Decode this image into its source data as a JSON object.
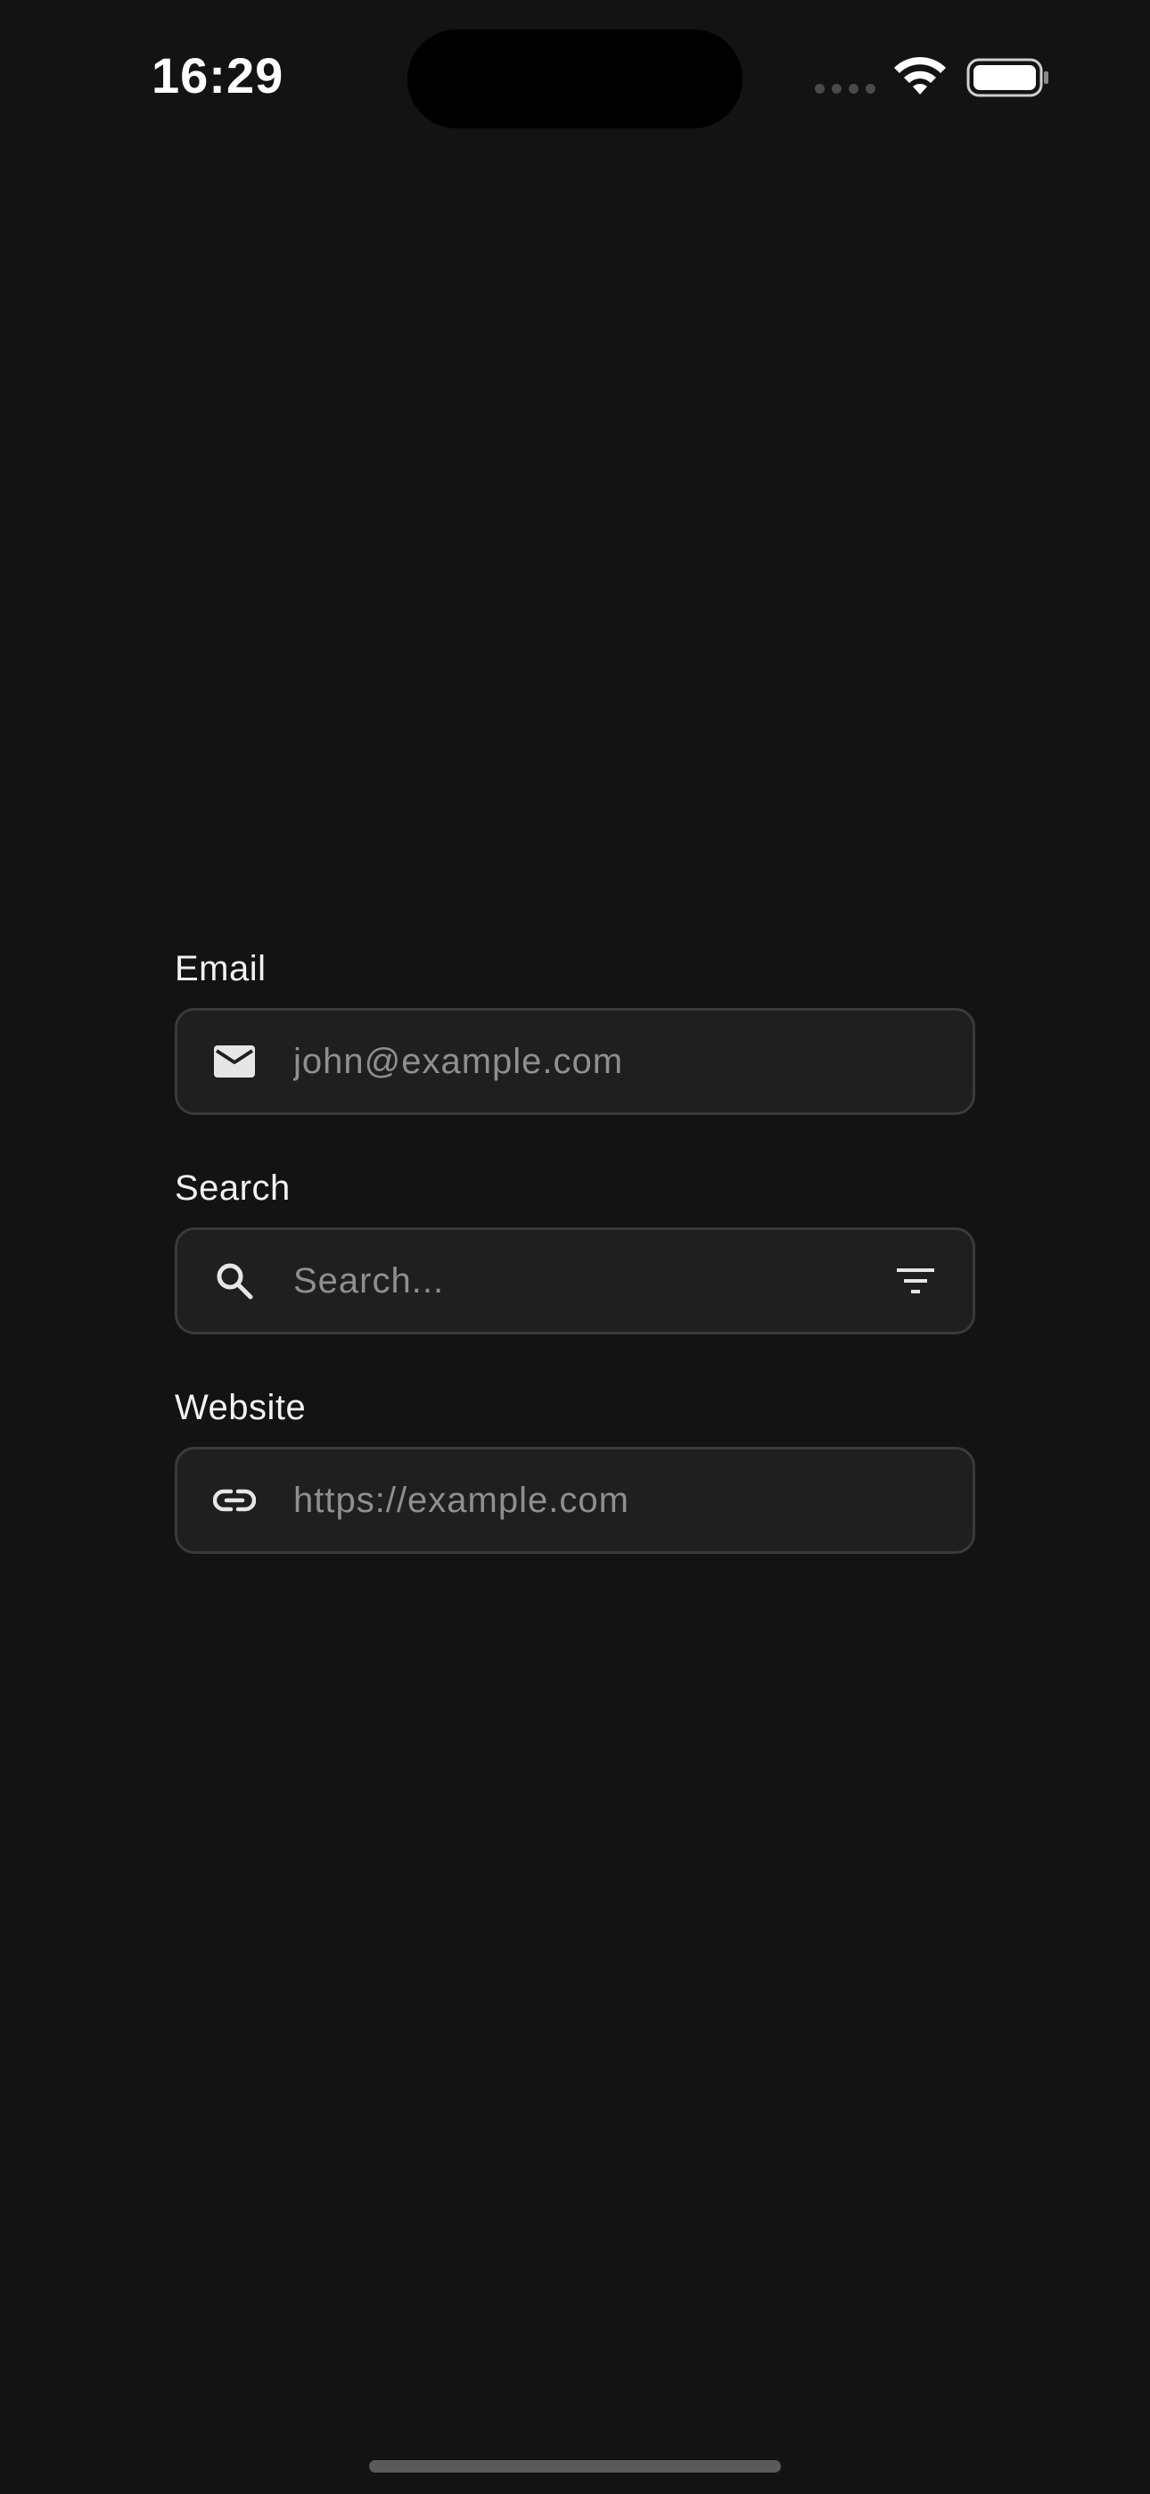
{
  "status_bar": {
    "time": "16:29",
    "icons": [
      "signal-icon",
      "wifi-icon",
      "battery-icon"
    ]
  },
  "form": {
    "fields": [
      {
        "label": "Email",
        "placeholder": "john@example.com",
        "value": "",
        "leading_icon": "mail-icon"
      },
      {
        "label": "Search",
        "placeholder": "Search...",
        "value": "",
        "leading_icon": "search-icon",
        "trailing_icon": "filter-icon"
      },
      {
        "label": "Website",
        "placeholder": "https://example.com",
        "value": "",
        "leading_icon": "link-icon"
      }
    ]
  },
  "colors": {
    "background": "#131313",
    "field_background": "#1f1f1f",
    "field_border": "#3a3a3a",
    "placeholder": "#8f8f8f",
    "text": "#ffffff"
  }
}
